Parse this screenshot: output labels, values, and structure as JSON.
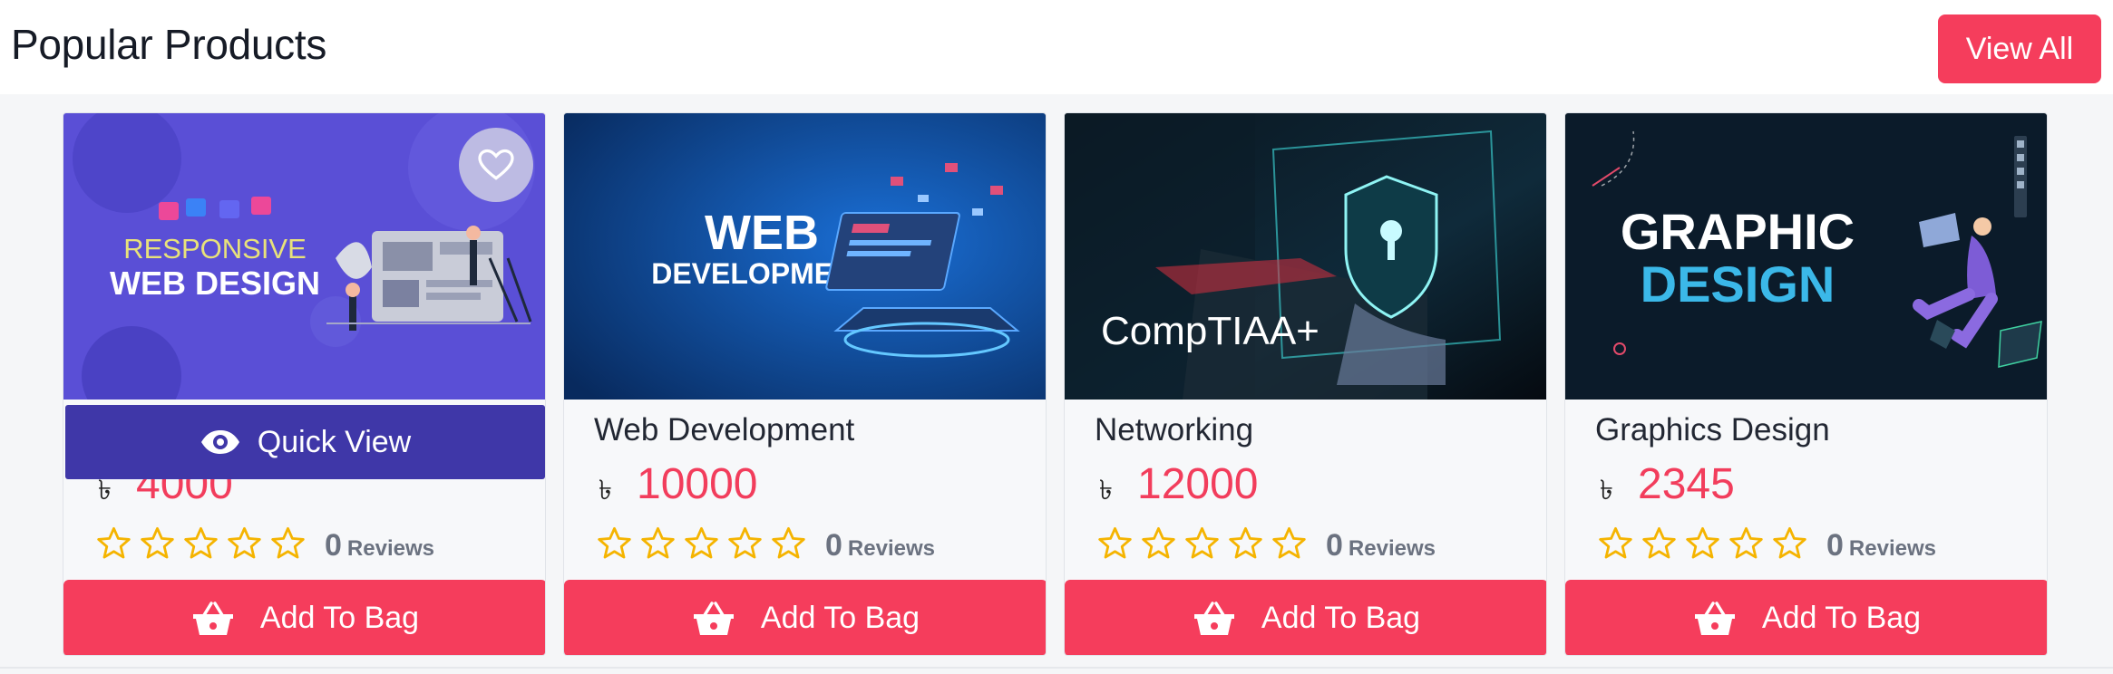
{
  "section": {
    "title": "Popular Products",
    "view_all_label": "View All"
  },
  "quick_view_label": "Quick View",
  "colors": {
    "accent": "#f53d5c",
    "quick_view_bg": "#3f37a8",
    "star": "#f5b400"
  },
  "icons": {
    "wishlist": "heart-icon",
    "quick_view": "eye-icon",
    "add_to_bag": "basket-icon",
    "rating": "star-icon"
  },
  "products": [
    {
      "name": "Responsive Web Design",
      "image_text": [
        "RESPONSIVE",
        "WEB DESIGN"
      ],
      "currency": "৳",
      "price": "4000",
      "rating": 0,
      "review_count": "0",
      "review_label": "Reviews",
      "add_label": "Add To Bag"
    },
    {
      "name": "Web Development",
      "image_text": [
        "WEB",
        "DEVELOPMENT"
      ],
      "currency": "৳",
      "price": "10000",
      "rating": 0,
      "review_count": "0",
      "review_label": "Reviews",
      "add_label": "Add To Bag"
    },
    {
      "name": "Networking",
      "image_text": [
        "CompTIAA+"
      ],
      "currency": "৳",
      "price": "12000",
      "rating": 0,
      "review_count": "0",
      "review_label": "Reviews",
      "add_label": "Add To Bag"
    },
    {
      "name": "Graphics Design",
      "image_text": [
        "GRAPHIC",
        "DESIGN"
      ],
      "currency": "৳",
      "price": "2345",
      "rating": 0,
      "review_count": "0",
      "review_label": "Reviews",
      "add_label": "Add To Bag"
    }
  ]
}
